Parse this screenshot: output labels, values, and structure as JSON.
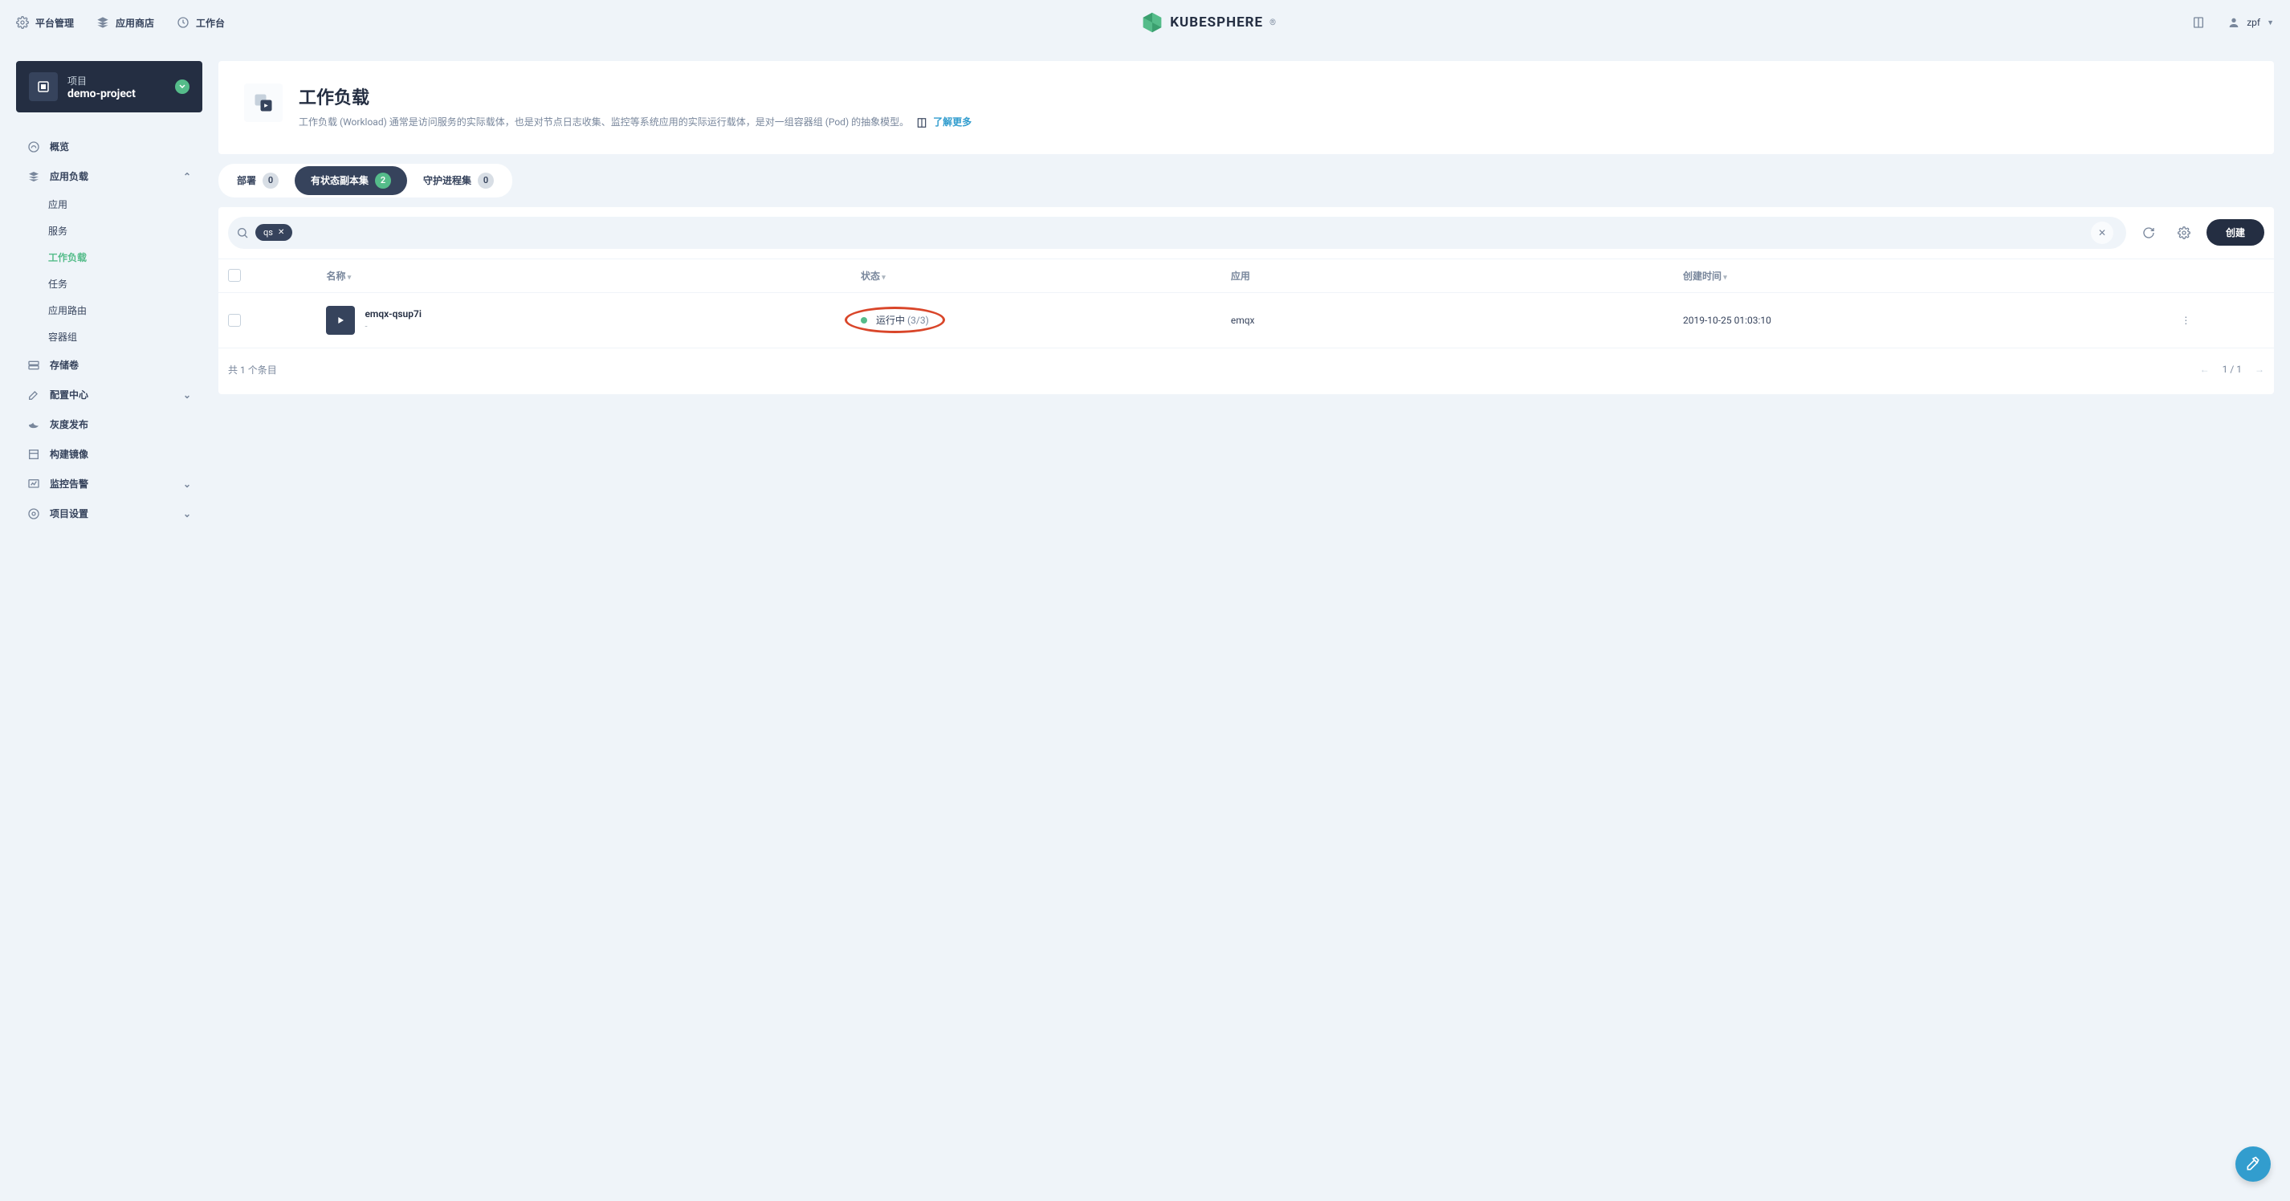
{
  "topbar": {
    "platform": "平台管理",
    "appstore": "应用商店",
    "workbench": "工作台",
    "brand": "KUBESPHERE",
    "username": "zpf"
  },
  "sidebar": {
    "project_label": "项目",
    "project_name": "demo-project",
    "items": [
      {
        "label": "概览",
        "has_chev": false
      },
      {
        "label": "应用负载",
        "has_chev": true,
        "expanded": true,
        "children": [
          {
            "label": "应用",
            "active": false
          },
          {
            "label": "服务",
            "active": false
          },
          {
            "label": "工作负载",
            "active": true
          },
          {
            "label": "任务",
            "active": false
          },
          {
            "label": "应用路由",
            "active": false
          },
          {
            "label": "容器组",
            "active": false
          }
        ]
      },
      {
        "label": "存储卷",
        "has_chev": false
      },
      {
        "label": "配置中心",
        "has_chev": true
      },
      {
        "label": "灰度发布",
        "has_chev": false
      },
      {
        "label": "构建镜像",
        "has_chev": false
      },
      {
        "label": "监控告警",
        "has_chev": true
      },
      {
        "label": "项目设置",
        "has_chev": true
      }
    ]
  },
  "header": {
    "title": "工作负载",
    "desc": "工作负载 (Workload) 通常是访问服务的实际载体，也是对节点日志收集、监控等系统应用的实际运行载体，是对一组容器组 (Pod) 的抽象模型。",
    "learn_more": "了解更多"
  },
  "tabs": [
    {
      "label": "部署",
      "count": "0",
      "active": false
    },
    {
      "label": "有状态副本集",
      "count": "2",
      "active": true
    },
    {
      "label": "守护进程集",
      "count": "0",
      "active": false
    }
  ],
  "search": {
    "chip": "qs"
  },
  "buttons": {
    "create": "创建"
  },
  "table": {
    "cols": {
      "name": "名称",
      "status": "状态",
      "app": "应用",
      "created": "创建时间"
    },
    "rows": [
      {
        "name": "emqx-qsup7i",
        "sub": "-",
        "status_text": "运行中",
        "status_count": "(3/3)",
        "app": "emqx",
        "created": "2019-10-25 01:03:10"
      }
    ],
    "footer_total": "共 1 个条目",
    "page": "1 / 1"
  }
}
